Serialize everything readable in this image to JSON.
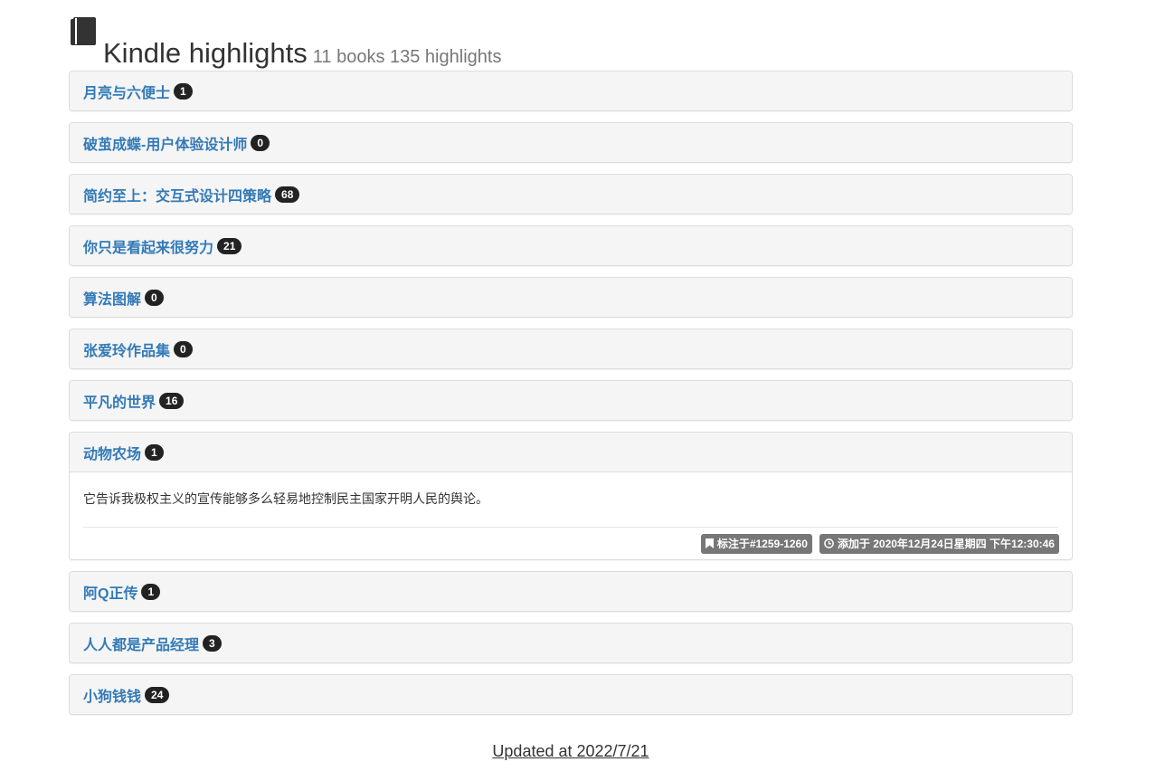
{
  "header": {
    "title": "Kindle highlights",
    "subtitle": "11 books 135 highlights",
    "icon": "book-icon"
  },
  "books": [
    {
      "title": "月亮与六便士",
      "count": "1"
    },
    {
      "title": "破茧成蝶-用户体验设计师",
      "count": "0"
    },
    {
      "title": "简约至上：交互式设计四策略",
      "count": "68"
    },
    {
      "title": "你只是看起来很努力",
      "count": "21"
    },
    {
      "title": "算法图解",
      "count": "0"
    },
    {
      "title": "张爱玲作品集",
      "count": "0"
    },
    {
      "title": "平凡的世界",
      "count": "16"
    },
    {
      "title": "动物农场",
      "count": "1",
      "expanded": true,
      "highlight": {
        "text": "它告诉我极权主义的宣传能够多么轻易地控制民主国家开明人民的舆论。",
        "location": "标注于#1259-1260",
        "added": "添加于 2020年12月24日星期四 下午12:30:46"
      }
    },
    {
      "title": "阿Q正传",
      "count": "1"
    },
    {
      "title": "人人都是产品经理",
      "count": "3"
    },
    {
      "title": "小狗钱钱",
      "count": "24"
    }
  ],
  "footer": {
    "updated": "Updated at 2022/7/21"
  },
  "colors": {
    "link": "#337ab7",
    "badge": "#222222",
    "label": "#777777",
    "panel_heading": "#f5f5f5"
  }
}
